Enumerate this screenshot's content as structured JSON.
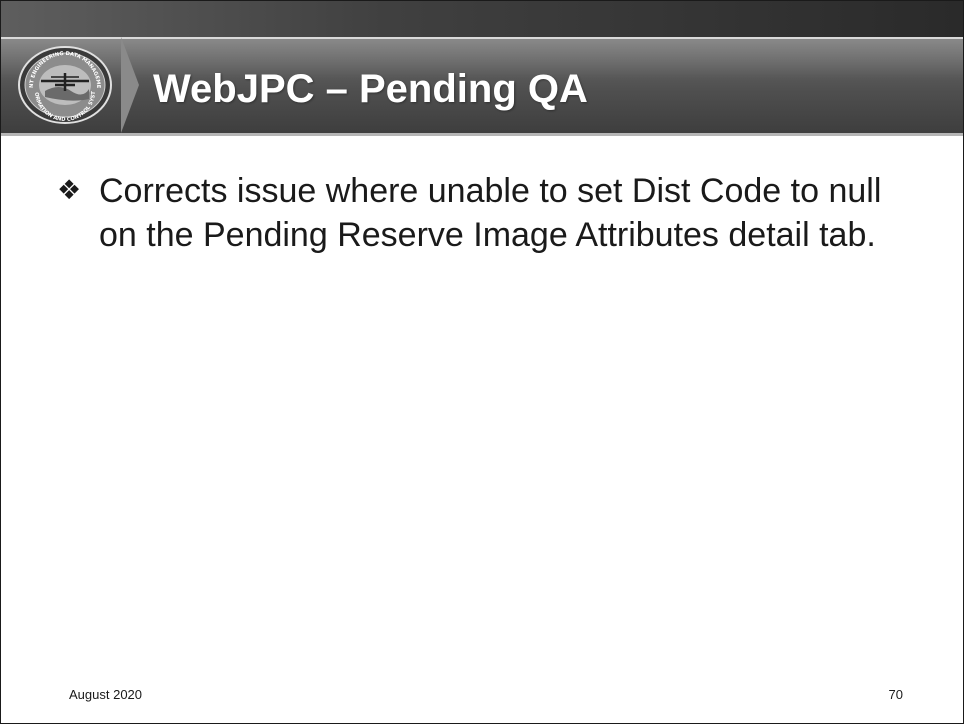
{
  "slide": {
    "title": "WebJPC – Pending QA",
    "bullets": [
      {
        "icon": "diamond-quad-bullet-icon",
        "symbol": "❖",
        "text": "Corrects issue where unable to set Dist Code to null on the Pending Reserve Image Attributes detail tab."
      }
    ],
    "footer": {
      "date": "August 2020",
      "page_number": "70"
    }
  },
  "logo": {
    "icon": "jedmics-seal-icon",
    "seal_text": "JOINT ENGINEERING DATA MANAGEMENT INFORMATION AND CONTROL SYSTEM"
  },
  "colors": {
    "header_dark": "#3e3e3e",
    "header_light": "#6f6f6f",
    "title_text": "#ffffff",
    "body_text": "#1a1a1a"
  }
}
